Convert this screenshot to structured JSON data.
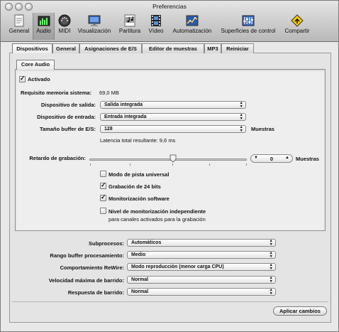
{
  "window": {
    "title": "Preferencias"
  },
  "toolbar": {
    "items": [
      {
        "label": "General",
        "icon": "general-icon"
      },
      {
        "label": "Audio",
        "icon": "audio-icon"
      },
      {
        "label": "MIDI",
        "icon": "midi-icon"
      },
      {
        "label": "Visualización",
        "icon": "display-icon"
      },
      {
        "label": "Partitura",
        "icon": "score-icon"
      },
      {
        "label": "Vídeo",
        "icon": "video-icon"
      },
      {
        "label": "Automatización",
        "icon": "automation-icon"
      },
      {
        "label": "Superficies de control",
        "icon": "control-surfaces-icon"
      },
      {
        "label": "Compartir",
        "icon": "share-icon"
      }
    ],
    "selected": "Audio"
  },
  "tabs": [
    "Dispositivos",
    "General",
    "Asignaciones de E/S",
    "Editor de muestras",
    "MP3",
    "Reiniciar"
  ],
  "active_tab": "Dispositivos",
  "subtab": "Core Audio",
  "core_audio": {
    "activado_label": "Activado",
    "activado_checked": true,
    "memory_label": "Requisito memoria sistema:",
    "memory_value": "69,0 MB",
    "output_label": "Dispositivo de salida:",
    "output_value": "Salida integrada",
    "input_label": "Dispositivo de entrada:",
    "input_value": "Entrada integrada",
    "buffer_label": "Tamaño buffer de E/S:",
    "buffer_value": "128",
    "buffer_unit": "Muestras",
    "latency_text": "Latencia total resultante: 9,6 ms",
    "record_delay_label": "Retardo de grabación:",
    "record_delay_value": "0",
    "record_delay_unit": "Muestras",
    "checkboxes": [
      {
        "label": "Modo de pista universal",
        "checked": false
      },
      {
        "label": "Grabación de 24 bits",
        "checked": true
      },
      {
        "label": "Monitorización software",
        "checked": true
      },
      {
        "label": "Nivel de monitorización independiente",
        "sublabel": "para canales activados para la grabación",
        "checked": false
      }
    ]
  },
  "settings": [
    {
      "label": "Subprocesos:",
      "value": "Automáticos"
    },
    {
      "label": "Rango buffer procesamiento:",
      "value": "Medio"
    },
    {
      "label": "Comportamiento ReWire:",
      "value": "Modo reproducción (menor carga CPU)"
    },
    {
      "label": "Velocidad máxima de barrido:",
      "value": "Normal"
    },
    {
      "label": "Respuesta de barrido:",
      "value": "Normal"
    }
  ],
  "apply_button": "Aplicar cambios",
  "colors": {
    "accent": "#5a8fd8"
  }
}
